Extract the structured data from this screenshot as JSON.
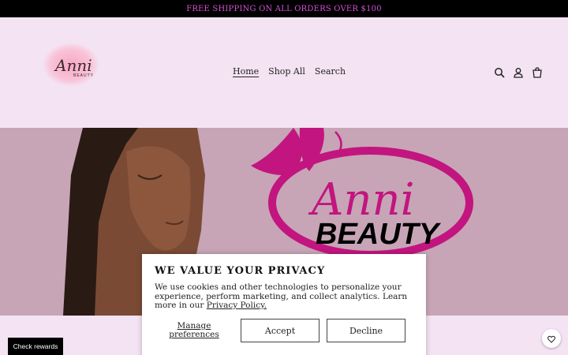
{
  "announcement": {
    "text": "FREE SHIPPING ON ALL ORDERS OVER $100"
  },
  "header": {
    "logo": {
      "script": "Anni",
      "tag": "BEAUTY"
    },
    "nav": [
      {
        "label": "Home",
        "active": true
      },
      {
        "label": "Shop All",
        "active": false
      },
      {
        "label": "Search",
        "active": false
      }
    ],
    "icons": [
      "search-icon",
      "account-icon",
      "cart-icon"
    ]
  },
  "hero": {
    "logo_script": "Anni",
    "logo_word": "BEAUTY",
    "colors": {
      "background": "#c7a5b6",
      "magenta": "#c2157f",
      "skin": "#7a4a35"
    }
  },
  "cookie_banner": {
    "title": "WE VALUE YOUR PRIVACY",
    "body": "We use cookies and other technologies to personalize your experience, perform marketing, and collect analytics. Learn more in our ",
    "link": "Privacy Policy.",
    "manage_label": "Manage preferences",
    "accept_label": "Accept",
    "decline_label": "Decline"
  },
  "rewards_button": {
    "label": "Check rewards"
  },
  "chat_icon": "chat-heart-icon",
  "colors": {
    "page_bg": "#f4e3f3",
    "announce_text": "#d64fd6",
    "announce_bg": "#000000"
  }
}
